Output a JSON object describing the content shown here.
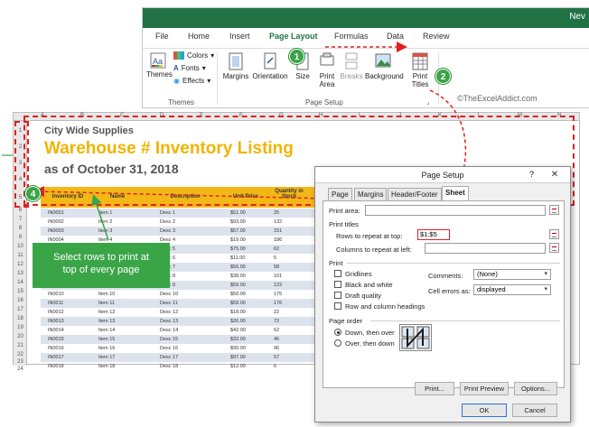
{
  "ribbon": {
    "app_title_fragment": "Nev",
    "tabs": [
      "File",
      "Home",
      "Insert",
      "Page Layout",
      "Formulas",
      "Data",
      "Review"
    ],
    "active_tab": "Page Layout",
    "themes_group": {
      "themes_label": "Themes",
      "colors_label": "Colors",
      "fonts_label": "Fonts",
      "effects_label": "Effects",
      "group_label": "Themes"
    },
    "page_setup_group": {
      "margins_label": "Margins",
      "orientation_label": "Orientation",
      "size_label": "Size",
      "print_area_line1": "Print",
      "print_area_line2": "Area",
      "breaks_label": "Breaks",
      "background_label": "Background",
      "print_titles_line1": "Print",
      "print_titles_line2": "Titles",
      "group_label": "Page Setup"
    },
    "accent_color": "#217346"
  },
  "copyright": "©TheExcelAddict.com",
  "sheet": {
    "col_headers": [
      "A",
      "B",
      "C",
      "D",
      "E",
      "F",
      "G",
      "H",
      "I",
      "J",
      "K",
      "L",
      "M",
      "N"
    ],
    "row_numbers": [
      "1",
      "2",
      "3",
      "4",
      "5",
      "6",
      "7",
      "8",
      "9",
      "10",
      "11",
      "12",
      "13",
      "14",
      "15",
      "16",
      "17",
      "18",
      "19",
      "20",
      "21",
      "22",
      "23",
      "24"
    ],
    "company": "City Wide Supplies",
    "title": "Warehouse # Inventory Listing",
    "date": "as of October 31, 2018",
    "title_color": "#f0b400",
    "header_color": "#f3b718",
    "columns": [
      "Inventory ID",
      "Name",
      "Description",
      "Unit Price",
      "Quantity in Stock",
      "V"
    ],
    "rows": [
      [
        "IN0001",
        "Item 1",
        "Desc 1",
        "$51.00",
        "25",
        "$1,"
      ],
      [
        "IN0002",
        "Item 2",
        "Desc 2",
        "$93.00",
        "132",
        "$12,"
      ],
      [
        "IN0003",
        "Item 3",
        "Desc 3",
        "$57.00",
        "151",
        "$8,"
      ],
      [
        "IN0004",
        "Item 4",
        "Desc 4",
        "$19.00",
        "186",
        "$3,"
      ],
      [
        "IN0005",
        "Item 5",
        "Desc 5",
        "$75.00",
        "62",
        "$4,"
      ],
      [
        "IN0006",
        "Item 6",
        "Desc 6",
        "$11.00",
        "5",
        ""
      ],
      [
        "IN0007",
        "Item 7",
        "Desc 7",
        "$56.00",
        "58",
        "$3,"
      ],
      [
        "IN0008",
        "Item 8",
        "Desc 8",
        "$38.00",
        "101",
        "$3,"
      ],
      [
        "IN0009",
        "Item 9",
        "Desc 9",
        "$59.00",
        "122",
        "$7,"
      ],
      [
        "IN0010",
        "Item 10",
        "Desc 10",
        "$50.00",
        "175",
        "$8,"
      ],
      [
        "IN0011",
        "Item 11",
        "Desc 11",
        "$59.00",
        "176",
        "$10,"
      ],
      [
        "IN0012",
        "Item 12",
        "Desc 12",
        "$18.00",
        "22",
        "$"
      ],
      [
        "IN0013",
        "Item 13",
        "Desc 13",
        "$26.00",
        "72",
        "$1,"
      ],
      [
        "IN0014",
        "Item 14",
        "Desc 14",
        "$42.00",
        "62",
        "$2,"
      ],
      [
        "IN0015",
        "Item 15",
        "Desc 15",
        "$32.00",
        "46",
        "$1,"
      ],
      [
        "IN0016",
        "Item 16",
        "Desc 16",
        "$90.00",
        "96",
        "$8,"
      ],
      [
        "IN0017",
        "Item 17",
        "Desc 17",
        "$97.00",
        "57",
        "$5,"
      ],
      [
        "IN0018",
        "Item 18",
        "Desc 18",
        "$12.00",
        "6",
        ""
      ]
    ]
  },
  "callout": {
    "line1": "Select rows to print at",
    "line2": "top of every page",
    "color": "#3aa547"
  },
  "steps": [
    "1",
    "2",
    "3",
    "4"
  ],
  "dialog": {
    "title": "Page Setup",
    "help": "?",
    "close": "✕",
    "tabs": [
      "Page",
      "Margins",
      "Header/Footer",
      "Sheet"
    ],
    "active_tab": "Sheet",
    "print_area_label": "Print area:",
    "print_area_value": "",
    "print_titles_label": "Print titles",
    "rows_repeat_label": "Rows to repeat at top:",
    "rows_repeat_value": "$1:$5",
    "cols_repeat_label": "Columns to repeat at left:",
    "cols_repeat_value": "",
    "print_section_label": "Print",
    "checkboxes": [
      "Gridlines",
      "Black and white",
      "Draft quality",
      "Row and column headings"
    ],
    "comments_label": "Comments:",
    "comments_value": "(None)",
    "cell_errors_label": "Cell errors as:",
    "cell_errors_value": "displayed",
    "page_order_label": "Page order",
    "order_down": "Down, then over",
    "order_over": "Over, then down",
    "buttons": {
      "print": "Print...",
      "preview": "Print Preview",
      "options": "Options...",
      "ok": "OK",
      "cancel": "Cancel"
    }
  },
  "annotation_color": "#e02020"
}
